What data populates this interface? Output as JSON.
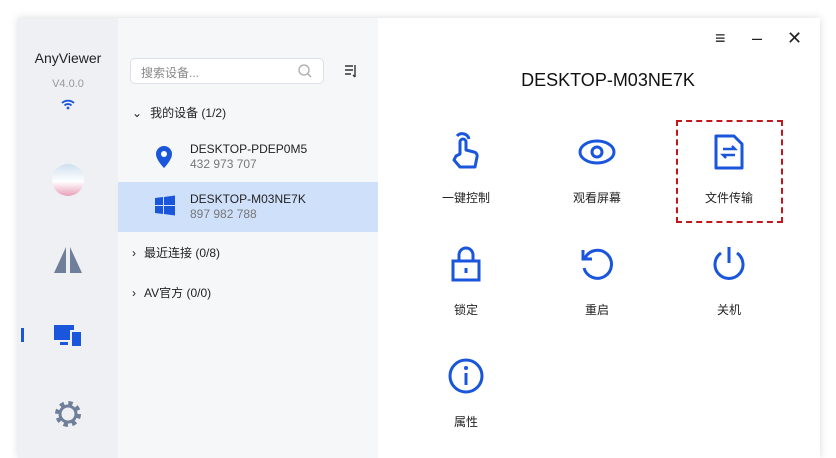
{
  "app": {
    "name": "AnyViewer",
    "version": "V4.0.0"
  },
  "search": {
    "placeholder": "搜索设备..."
  },
  "groups": [
    {
      "label": "我的设备 (1/2)",
      "expanded": true
    },
    {
      "label": "最近连接 (0/8)",
      "expanded": false
    },
    {
      "label": "AV官方 (0/0)",
      "expanded": false
    }
  ],
  "devices": [
    {
      "name": "DESKTOP-PDEP0M5",
      "id": "432 973 707",
      "icon": "location-pin-icon"
    },
    {
      "name": "DESKTOP-M03NE7K",
      "id": "897 982 788",
      "icon": "windows-icon",
      "selected": true
    }
  ],
  "main": {
    "title": "DESKTOP-M03NE7K",
    "actions": [
      {
        "label": "一键控制",
        "icon": "touch-icon"
      },
      {
        "label": "观看屏幕",
        "icon": "eye-icon"
      },
      {
        "label": "文件传输",
        "icon": "file-transfer-icon"
      },
      {
        "label": "锁定",
        "icon": "lock-icon"
      },
      {
        "label": "重启",
        "icon": "restart-icon"
      },
      {
        "label": "关机",
        "icon": "power-icon"
      },
      {
        "label": "属性",
        "icon": "info-icon"
      }
    ]
  },
  "colors": {
    "accent": "#1a56db",
    "highlight": "#c0171b",
    "selected": "#cfe0fb"
  }
}
